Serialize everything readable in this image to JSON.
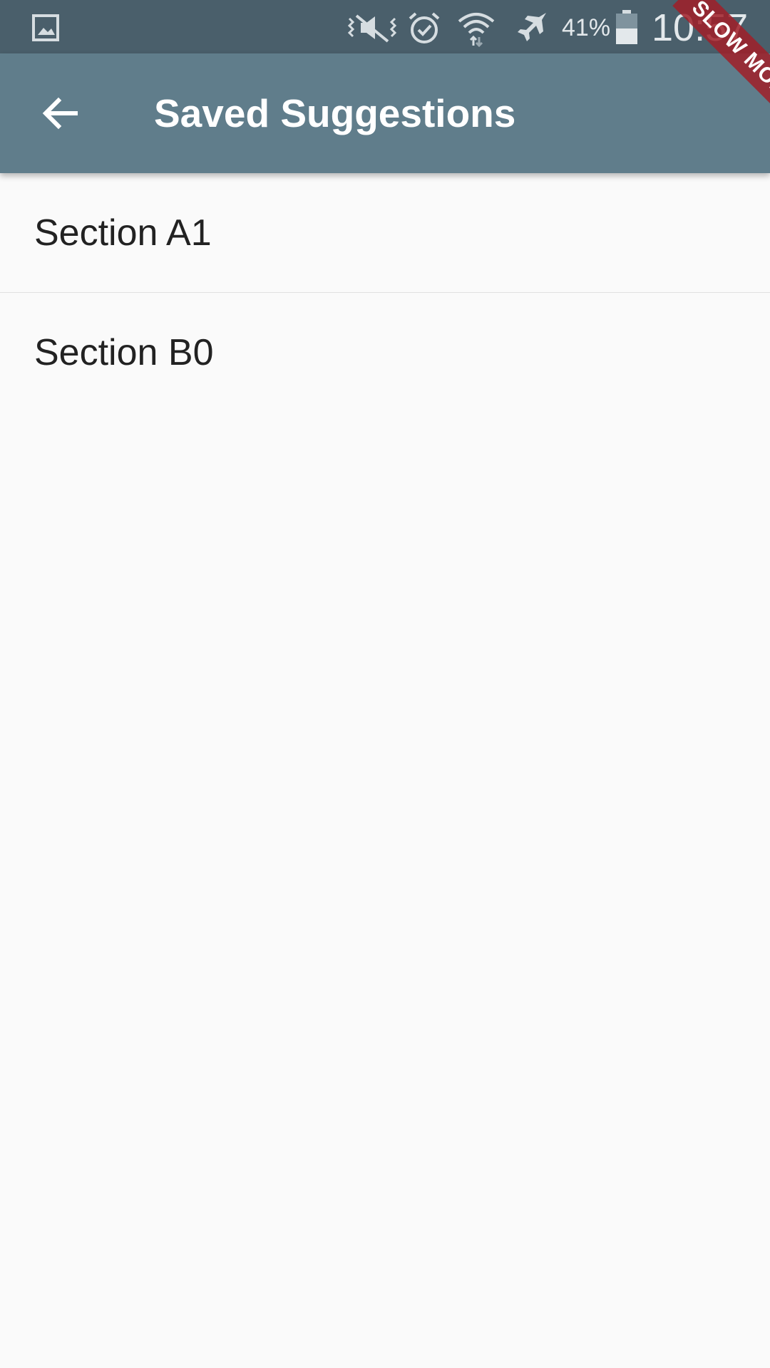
{
  "status_bar": {
    "battery_percent": "41%",
    "time": "10:57",
    "icons": [
      "gallery-icon",
      "mute-icon",
      "alarm-icon",
      "wifi-icon",
      "airplane-icon",
      "battery-icon"
    ]
  },
  "app_bar": {
    "title": "Saved Suggestions",
    "back_icon": "arrow-back-icon",
    "color": "#607d8b"
  },
  "list": {
    "items": [
      {
        "label": "Section A1"
      },
      {
        "label": "Section B0"
      }
    ]
  },
  "debug_banner": {
    "label": "SLOW MODE",
    "color": "#a01e28"
  }
}
